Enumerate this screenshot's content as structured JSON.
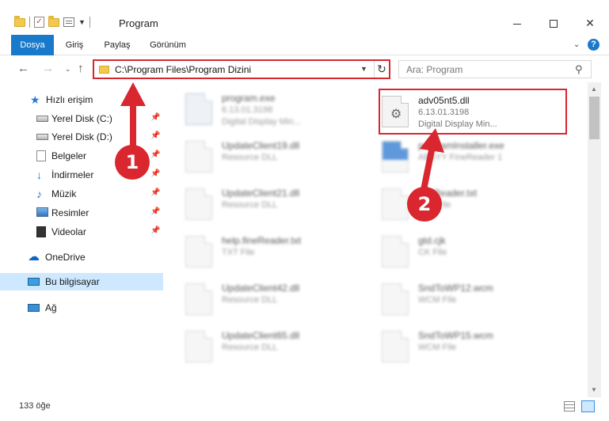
{
  "window": {
    "title": "Program",
    "minimize_icon": "minimize-icon",
    "maximize_icon": "maximize-icon",
    "close_label": "✕"
  },
  "ribbon": {
    "tabs": [
      "Dosya",
      "Giriş",
      "Paylaş",
      "Görünüm"
    ],
    "help_label": "?"
  },
  "navigation": {
    "back_label": "←",
    "forward_label": "→",
    "recent_label": "⌄",
    "up_label": "↑",
    "address": "C:\\Program Files\\Program Dizini",
    "refresh_label": "↻",
    "search_placeholder": "Ara: Program"
  },
  "sidebar": {
    "items": [
      {
        "label": "Hızlı erişim",
        "icon": "star-icon"
      },
      {
        "label": "Yerel Disk (C:)",
        "icon": "disk-icon",
        "pinned": true
      },
      {
        "label": "Yerel Disk (D:)",
        "icon": "disk-icon",
        "pinned": true
      },
      {
        "label": "Belgeler",
        "icon": "documents-icon",
        "pinned": true
      },
      {
        "label": "İndirmeler",
        "icon": "downloads-icon",
        "pinned": true
      },
      {
        "label": "Müzik",
        "icon": "music-icon",
        "pinned": true
      },
      {
        "label": "Resimler",
        "icon": "pictures-icon",
        "pinned": true
      },
      {
        "label": "Videolar",
        "icon": "videos-icon",
        "pinned": true
      },
      {
        "label": "OneDrive",
        "icon": "cloud-icon"
      },
      {
        "label": "Bu bilgisayar",
        "icon": "computer-icon",
        "selected": true
      },
      {
        "label": "Ağ",
        "icon": "network-icon"
      }
    ]
  },
  "files": {
    "left": [
      {
        "name": "program.exe",
        "line2": "6.13.01.3198",
        "line3": "Digital Display Min..."
      },
      {
        "name": "UpdateClient19.dll",
        "line2": "Resource DLL"
      },
      {
        "name": "UpdateClient21.dll",
        "line2": "Resource DLL"
      },
      {
        "name": "help.fineReader.txt",
        "line2": "TXT File"
      },
      {
        "name": "UpdateClient42.dll",
        "line2": "Resource DLL"
      },
      {
        "name": "UpdateClient65.dll",
        "line2": "Resource DLL"
      }
    ],
    "right": [
      {
        "name": "adv05nt5.dll",
        "line2": "6.13.01.3198",
        "line3": "Digital Display Min..."
      },
      {
        "name": "programInstaller.exe",
        "line2": "ABBYY FineReader 1"
      },
      {
        "name": "fineReader.txt",
        "line2": "TXT File"
      },
      {
        "name": "gtd.cjk",
        "line2": "CK File"
      },
      {
        "name": "SndToWP12.wcm",
        "line2": "WCM File"
      },
      {
        "name": "SndToWP15.wcm",
        "line2": "WCM File"
      }
    ]
  },
  "status": {
    "count": "133 öğe"
  },
  "annotations": {
    "badge1": "1",
    "badge2": "2",
    "accent_color": "#d9262f"
  }
}
